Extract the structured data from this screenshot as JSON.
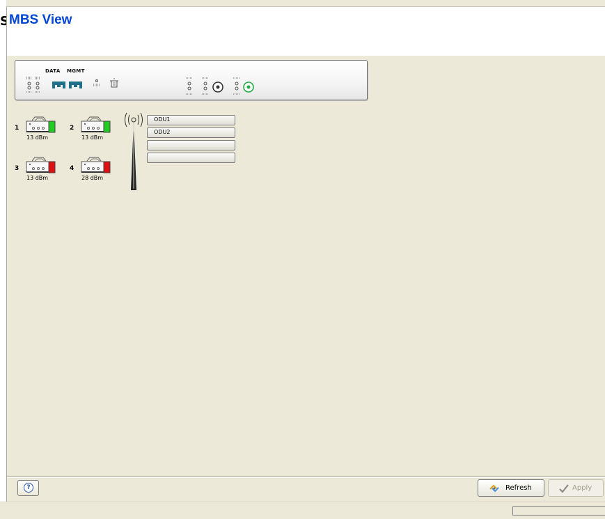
{
  "page": {
    "title": "MBS View",
    "left_fragment": "S"
  },
  "panel": {
    "data_label": "DATA",
    "mgmt_label": "MGMT"
  },
  "units": [
    {
      "number": "1",
      "power": "13 dBm",
      "status_color": "#22cc22"
    },
    {
      "number": "2",
      "power": "13 dBm",
      "status_color": "#22cc22"
    },
    {
      "number": "3",
      "power": "13 dBm",
      "status_color": "#dd1111"
    },
    {
      "number": "4",
      "power": "28 dBm",
      "status_color": "#dd1111"
    }
  ],
  "odu_slots": [
    "ODU1",
    "ODU2",
    "",
    ""
  ],
  "footer": {
    "help_icon": "help-icon",
    "refresh_label": "Refresh",
    "apply_label": "Apply",
    "apply_enabled": false
  },
  "colors": {
    "title": "#0046d5",
    "background": "#ece9d8",
    "ok": "#22cc22",
    "fault": "#dd1111"
  }
}
